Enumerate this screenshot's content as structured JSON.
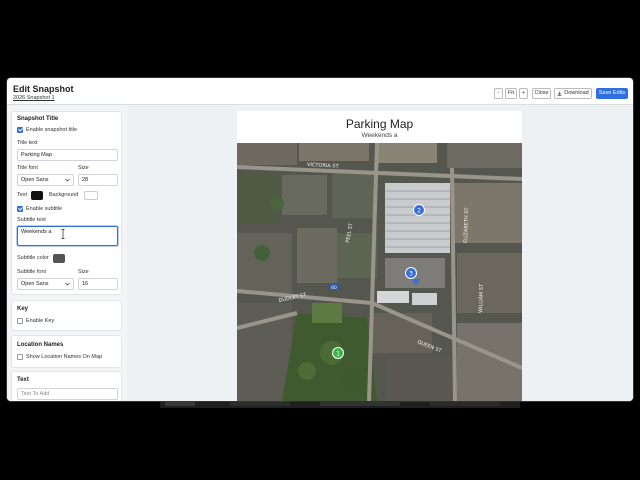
{
  "window": {
    "title": "Edit Snapshot",
    "subtitle": "2026 Snapshot 1",
    "toolbar": {
      "minus_label": "-",
      "fit_label": "Fit",
      "plus_label": "+",
      "close_label": "Close",
      "download_label": "Download",
      "save_label": "Save Edits"
    }
  },
  "sidebar": {
    "snapshot_title": {
      "heading": "Snapshot Title",
      "enable_title_label": "Enable snapshot title",
      "enable_title_checked": true,
      "title_text_label": "Title text",
      "title_text_value": "Parking Map",
      "title_font_label": "Title font",
      "title_font_value": "Open Sans",
      "size_label": "Size",
      "size_value": "28",
      "text_label": "Text",
      "background_label": "Background",
      "text_color": "#111111",
      "background_color": "#ffffff",
      "enable_subtitle_label": "Enable subtitle",
      "enable_subtitle_checked": true,
      "subtitle_text_label": "Subtitle text",
      "subtitle_text_value": "Weekends a",
      "subtitle_color_label": "Subtitle color",
      "subtitle_color": "#555555",
      "subtitle_font_label": "Subtitle font",
      "subtitle_font_value": "Open Sans",
      "subtitle_size_label": "Size",
      "subtitle_size_value": "16"
    },
    "key": {
      "heading": "Key",
      "enable_key_label": "Enable Key",
      "enable_key_checked": false
    },
    "location_names": {
      "heading": "Location Names",
      "show_label": "Show Location Names On Map",
      "show_checked": false
    },
    "text": {
      "heading": "Text",
      "placeholder": "Text To Add"
    }
  },
  "preview": {
    "title": "Parking Map",
    "subtitle": "Weekends a",
    "markers": [
      {
        "label": "2",
        "color": "#3b6fd6"
      },
      {
        "label": "3",
        "color": "#3b6fd6"
      },
      {
        "label": "1",
        "color": "#3bb44a"
      }
    ],
    "street_labels": [
      "VICTORIA ST",
      "DUDLEY ST",
      "PEEL ST",
      "QUEEN ST",
      "ELIZABETH ST",
      "WILLIAM ST"
    ],
    "shield_label": "60"
  },
  "accent_color": "#2f6fe0"
}
